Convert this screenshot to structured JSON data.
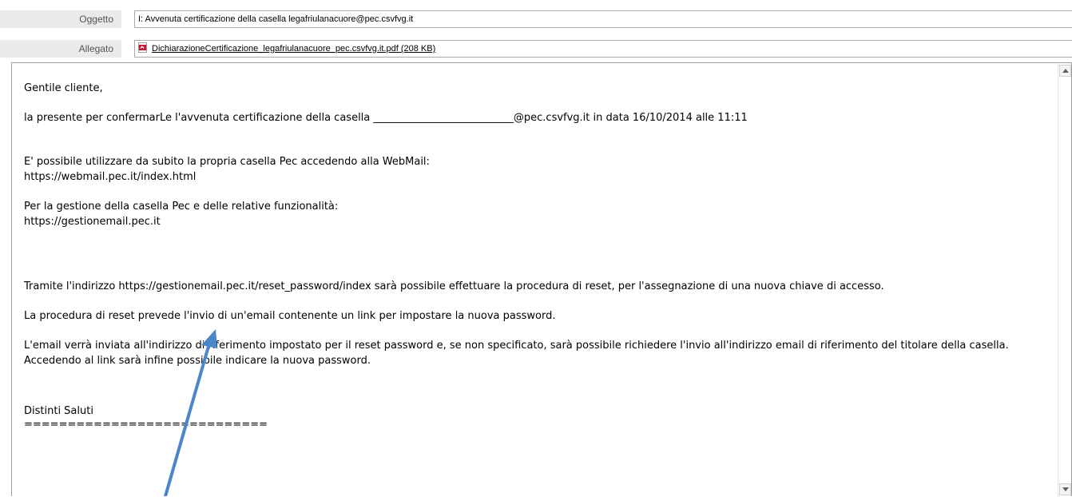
{
  "header": {
    "subject_label": "Oggetto",
    "subject_value": "I: Avvenuta certificazione della casella legafriulanacuore@pec.csvfvg.it",
    "attachment_label": "Allegato",
    "attachment_name": "DichiarazioneCertificazione_legafriulanacuore_pec.csvfvg.it.pdf (208 KB)",
    "attachment_icon": "pdf-icon"
  },
  "body": {
    "greeting": "Gentile cliente,",
    "confirmation": "la presente per confermarLe l'avvenuta certificazione della casella ___________________________@pec.csvfvg.it in data 16/10/2014 alle 11:11",
    "webmail_intro": "E' possibile utilizzare da subito la propria casella Pec accedendo alla WebMail:",
    "webmail_url": "https://webmail.pec.it/index.html",
    "management_intro": "Per la gestione della casella Pec e delle relative funzionalità:",
    "management_url": "https://gestionemail.pec.it",
    "reset_info": "Tramite l'indirizzo https://gestionemail.pec.it/reset_password/index sarà possibile effettuare la procedura di reset, per l'assegnazione di una nuova chiave di accesso.",
    "reset_procedure": "La procedura di reset prevede l'invio di un'email contenente un link per impostare la nuova password.",
    "email_info": "L'email verrà inviata all'indirizzo di riferimento impostato per il reset password e, se non specificato, sarà possibile richiedere l'invio all'indirizzo email di riferimento del titolare della casella. Accedendo al link sarà infine possibile indicare la nuova password.",
    "closing": "Distinti Saluti",
    "separator": "============================"
  },
  "colors": {
    "annotation_arrow": "#4a86c8",
    "label_background": "#eaeaea",
    "pdf_icon_red": "#c8102e"
  }
}
